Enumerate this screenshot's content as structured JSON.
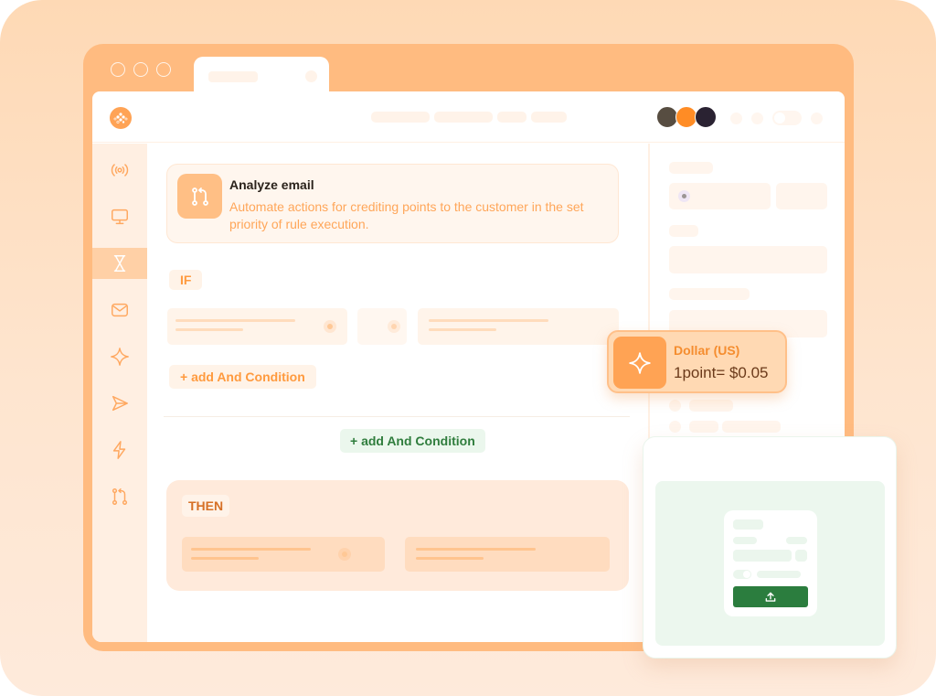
{
  "browser": {
    "window_controls": [
      "circle",
      "circle",
      "circle"
    ],
    "tab_icon": "tab-close-icon"
  },
  "header": {
    "logo_icon": "app-logo-icon",
    "avatars": [
      {
        "color": "#574d41"
      },
      {
        "color": "#ff8c25"
      },
      {
        "color": "#2a2232"
      }
    ]
  },
  "sidebar": {
    "items": [
      {
        "icon": "broadcast-icon",
        "active": false
      },
      {
        "icon": "monitor-icon",
        "active": false
      },
      {
        "icon": "hourglass-icon",
        "active": true
      },
      {
        "icon": "mail-icon",
        "active": false
      },
      {
        "icon": "sparkle-icon",
        "active": false
      },
      {
        "icon": "send-icon",
        "active": false
      },
      {
        "icon": "lightning-icon",
        "active": false
      },
      {
        "icon": "git-branch-icon",
        "active": false
      }
    ]
  },
  "rule": {
    "title": "Analyze email",
    "description": "Automate actions for crediting points to the customer in the set priority of rule execution."
  },
  "conditions": {
    "if_label": "IF",
    "add_and_condition_label": "+ add And Condition",
    "add_and_condition_group_label": "+ add And Condition",
    "then_label": "THEN"
  },
  "currency": {
    "name": "Dollar (US)",
    "rate": "1point= $0.05"
  },
  "colors": {
    "accent": "#ffa354",
    "accent_light": "#ffbb80",
    "success": "#2b7d3e"
  }
}
